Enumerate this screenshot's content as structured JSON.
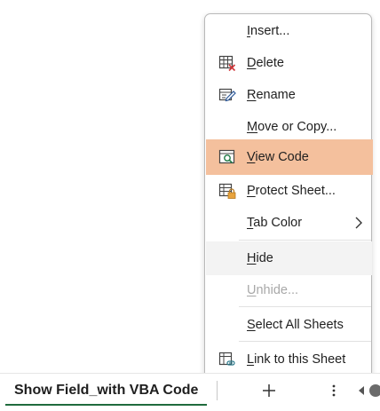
{
  "context_menu": {
    "items": [
      {
        "id": "insert",
        "pre": "",
        "u": "I",
        "post": "nsert...",
        "icon": "none"
      },
      {
        "id": "delete",
        "pre": "",
        "u": "D",
        "post": "elete",
        "icon": "delete-sheet-icon"
      },
      {
        "id": "rename",
        "pre": "",
        "u": "R",
        "post": "ename",
        "icon": "rename-sheet-icon"
      },
      {
        "id": "move-copy",
        "pre": "",
        "u": "M",
        "post": "ove or Copy...",
        "icon": "none"
      },
      {
        "id": "view-code",
        "pre": "",
        "u": "V",
        "post": "iew Code",
        "icon": "view-code-icon",
        "state": "highlighted"
      },
      {
        "id": "protect-sheet",
        "pre": "",
        "u": "P",
        "post": "rotect Sheet...",
        "icon": "protect-sheet-icon"
      },
      {
        "id": "tab-color",
        "pre": "",
        "u": "T",
        "post": "ab Color",
        "icon": "none",
        "submenu": true
      },
      {
        "id": "hide",
        "pre": "",
        "u": "H",
        "post": "ide",
        "icon": "none",
        "state": "hover"
      },
      {
        "id": "unhide",
        "pre": "",
        "u": "U",
        "post": "nhide...",
        "icon": "none",
        "state": "disabled"
      },
      {
        "id": "select-all-sheets",
        "pre": "",
        "u": "S",
        "post": "elect All Sheets",
        "icon": "none"
      },
      {
        "id": "link-to-sheet",
        "pre": "",
        "u": "L",
        "post": "ink to this Sheet",
        "icon": "link-sheet-icon"
      }
    ]
  },
  "sheet_tabs": {
    "active_tab": "Show Field_with VBA Code"
  },
  "colors": {
    "highlight": "#f4c09d",
    "active_tab_underline": "#1f6b3d",
    "disabled_text": "#a8a8a8"
  }
}
